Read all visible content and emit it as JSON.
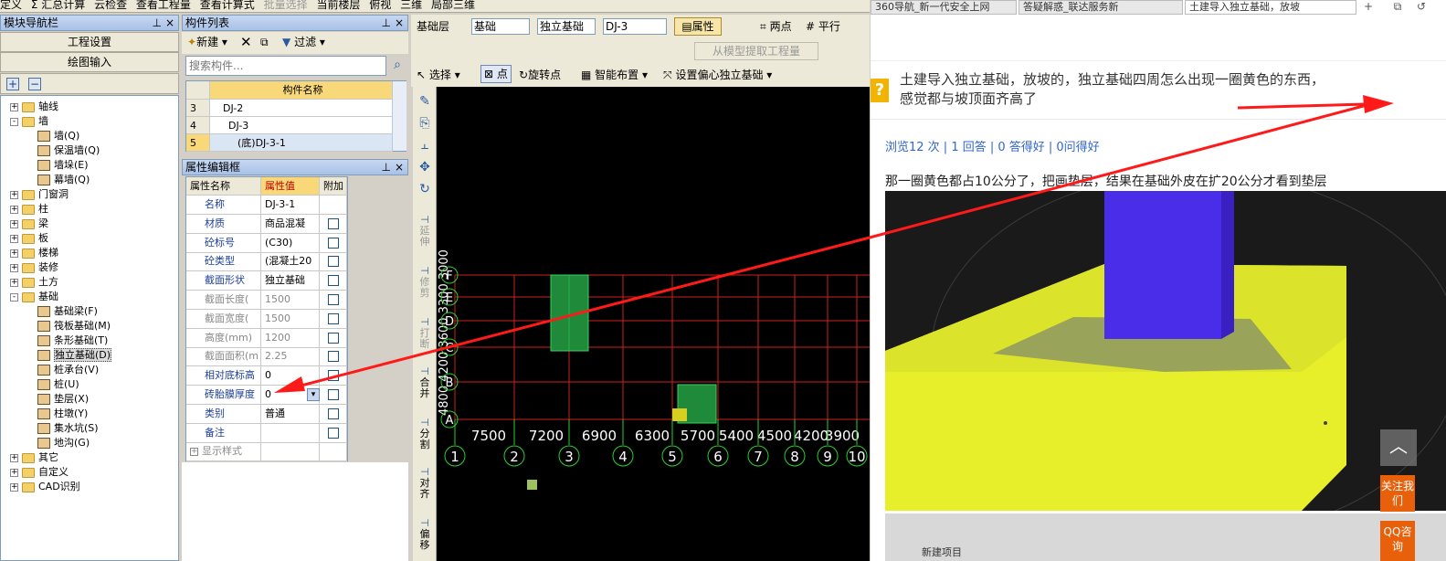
{
  "top_toolbar": {
    "items": [
      "定义",
      "Σ 汇总计算",
      "云检查",
      "查看工程量",
      "查看计算式",
      "批量选择",
      "当前楼层",
      "俯视",
      "三维",
      "局部三维"
    ]
  },
  "nav_panel": {
    "title": "模块导航栏",
    "project_settings": "工程设置",
    "drawing_input": "绘图输入",
    "tree": [
      {
        "label": "轴线",
        "level": 0,
        "exp": "+",
        "type": "folder"
      },
      {
        "label": "墙",
        "level": 0,
        "exp": "-",
        "type": "folder"
      },
      {
        "label": "墙(Q)",
        "level": 1,
        "type": "leaf"
      },
      {
        "label": "保温墙(Q)",
        "level": 1,
        "type": "leaf"
      },
      {
        "label": "墙垛(E)",
        "level": 1,
        "type": "leaf"
      },
      {
        "label": "幕墙(Q)",
        "level": 1,
        "type": "leaf"
      },
      {
        "label": "门窗洞",
        "level": 0,
        "exp": "+",
        "type": "folder"
      },
      {
        "label": "柱",
        "level": 0,
        "exp": "+",
        "type": "folder"
      },
      {
        "label": "梁",
        "level": 0,
        "exp": "+",
        "type": "folder"
      },
      {
        "label": "板",
        "level": 0,
        "exp": "+",
        "type": "folder"
      },
      {
        "label": "楼梯",
        "level": 0,
        "exp": "+",
        "type": "folder"
      },
      {
        "label": "装修",
        "level": 0,
        "exp": "+",
        "type": "folder"
      },
      {
        "label": "土方",
        "level": 0,
        "exp": "+",
        "type": "folder"
      },
      {
        "label": "基础",
        "level": 0,
        "exp": "-",
        "type": "folder"
      },
      {
        "label": "基础梁(F)",
        "level": 1,
        "type": "leaf"
      },
      {
        "label": "筏板基础(M)",
        "level": 1,
        "type": "leaf"
      },
      {
        "label": "条形基础(T)",
        "level": 1,
        "type": "leaf"
      },
      {
        "label": "独立基础(D)",
        "level": 1,
        "type": "leaf",
        "selected": true
      },
      {
        "label": "桩承台(V)",
        "level": 1,
        "type": "leaf"
      },
      {
        "label": "桩(U)",
        "level": 1,
        "type": "leaf"
      },
      {
        "label": "垫层(X)",
        "level": 1,
        "type": "leaf"
      },
      {
        "label": "柱墩(Y)",
        "level": 1,
        "type": "leaf"
      },
      {
        "label": "集水坑(S)",
        "level": 1,
        "type": "leaf"
      },
      {
        "label": "地沟(G)",
        "level": 1,
        "type": "leaf"
      },
      {
        "label": "其它",
        "level": 0,
        "exp": "+",
        "type": "folder"
      },
      {
        "label": "自定义",
        "level": 0,
        "exp": "+",
        "type": "folder"
      },
      {
        "label": "CAD识别",
        "level": 0,
        "exp": "+",
        "type": "folder"
      }
    ]
  },
  "component_list": {
    "title": "构件列表",
    "new_label": "新建",
    "filter_label": "过滤",
    "search_placeholder": "搜索构件...",
    "header": "构件名称",
    "rows": [
      {
        "num": "3",
        "name": "DJ-2"
      },
      {
        "num": "4",
        "name": "DJ-3"
      },
      {
        "num": "5",
        "name": "(底)DJ-3-1"
      }
    ]
  },
  "property_panel": {
    "title": "属性编辑框",
    "headers": [
      "属性名称",
      "属性值",
      "附加"
    ],
    "rows": [
      {
        "name": "名称",
        "value": "DJ-3-1",
        "check": false,
        "blue": true
      },
      {
        "name": "材质",
        "value": "商品混凝",
        "check": true,
        "blue": true
      },
      {
        "name": "砼标号",
        "value": "(C30)",
        "check": true,
        "blue": true
      },
      {
        "name": "砼类型",
        "value": "(混凝土20",
        "check": true,
        "blue": true
      },
      {
        "name": "截面形状",
        "value": "独立基础",
        "check": true,
        "blue": true
      },
      {
        "name": "截面长度(",
        "value": "1500",
        "check": true,
        "blue": false
      },
      {
        "name": "截面宽度(",
        "value": "1500",
        "check": true,
        "blue": false
      },
      {
        "name": "高度(mm)",
        "value": "1200",
        "check": true,
        "blue": false
      },
      {
        "name": "截面面积(m",
        "value": "2.25",
        "check": true,
        "blue": false
      },
      {
        "name": "相对底标高",
        "value": "0",
        "check": true,
        "blue": true
      },
      {
        "name": "砖胎膜厚度",
        "value": "0",
        "check": true,
        "blue": true
      },
      {
        "name": "类别",
        "value": "普通",
        "check": true,
        "blue": true
      },
      {
        "name": "备注",
        "value": "",
        "check": true,
        "blue": true
      },
      {
        "name": "显示样式",
        "value": "",
        "check": false,
        "blue": false,
        "exp": "+"
      }
    ]
  },
  "cad_toolbar": {
    "row1": [
      "基础层",
      "基础",
      "独立基础",
      "DJ-3",
      "属性",
      "两点",
      "平行"
    ],
    "row2": [
      "从模型提取工程量"
    ],
    "row3": [
      "选择",
      "点",
      "旋转点",
      "智能布置",
      "设置偏心独立基础"
    ]
  },
  "cad_view": {
    "row_labels": [
      "F",
      "E",
      "D",
      "C",
      "B",
      "A"
    ],
    "col_labels": [
      "1",
      "2",
      "3",
      "4",
      "5",
      "6",
      "7",
      "8",
      "9",
      "10"
    ],
    "dims": [
      "7500",
      "7200",
      "6900",
      "6300",
      "5700",
      "5400",
      "4500",
      "4200",
      "3900"
    ],
    "vertical_dims": "4800 4200 3600 3300 3000"
  },
  "vertical_tools": [
    "延伸",
    "修剪",
    "打断",
    "合并",
    "分割",
    "对齐",
    "偏移"
  ],
  "browser": {
    "tabs": [
      "360导航_新一代安全上网",
      "答疑解惑_联达服务新",
      "土建导入独立基础，放坡"
    ],
    "question_title_1": "土建导入独立基础，放坡的，独立基础四周怎么出现一圈黄色的东西，",
    "question_title_2": "感觉都与坡顶面齐高了",
    "stats": "浏览12 次 | 1 回答 | 0 答得好 | 0问得好",
    "body": "那一圈黄色都占10公分了，把画垫层，结果在基础外皮在扩20公分才看到垫层",
    "side_follow": "关注我们",
    "side_qq": "QQ咨询",
    "bottom_strip": "新建项目  ",
    "accent": "#e8600a"
  }
}
